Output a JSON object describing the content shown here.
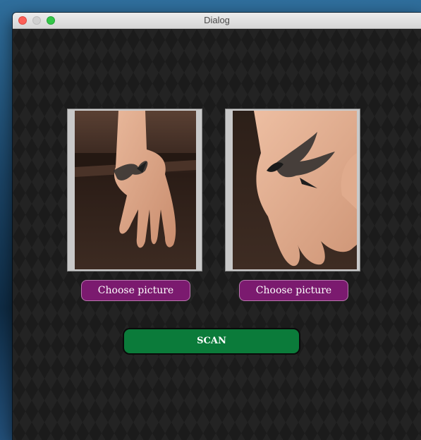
{
  "window": {
    "title": "Dialog"
  },
  "images": [
    {
      "icon": "swallow-tattoo-hand-photo"
    },
    {
      "icon": "swallow-tattoo-hand-closeup-photo"
    }
  ],
  "buttons": {
    "choose_left": "Choose picture",
    "choose_right": "Choose picture",
    "scan": "SCAN"
  },
  "colors": {
    "choose_button": "#7b1a6f",
    "scan_button": "#0b7b3a",
    "close": "#fc5f57",
    "maximize": "#33c748"
  }
}
